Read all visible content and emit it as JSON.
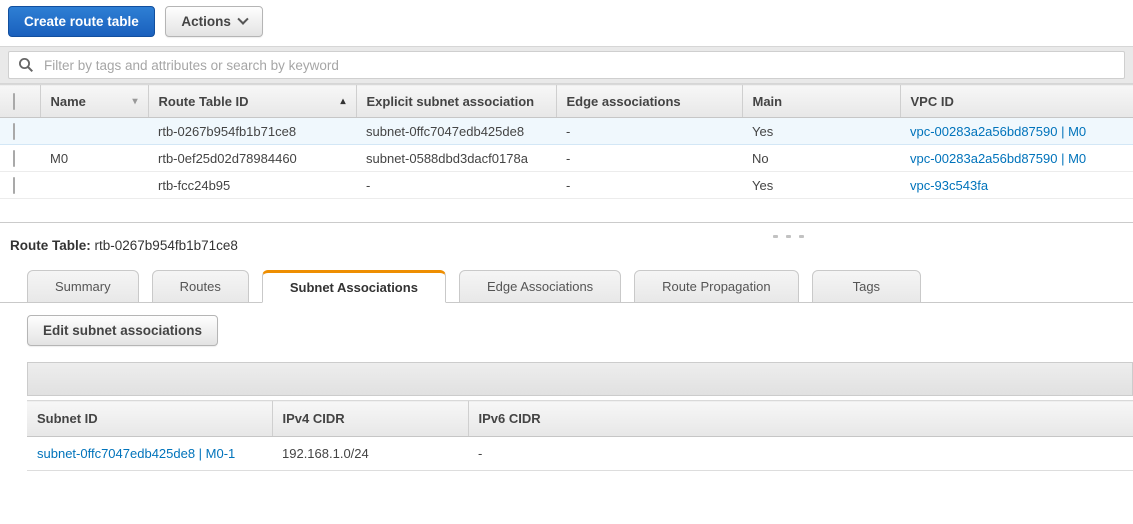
{
  "toolbar": {
    "create_button": "Create route table",
    "actions_button": "Actions"
  },
  "filter": {
    "placeholder": "Filter by tags and attributes or search by keyword"
  },
  "route_tables_table": {
    "columns": {
      "name": "Name",
      "route_table_id": "Route Table ID",
      "explicit_subnet_association": "Explicit subnet association",
      "edge_associations": "Edge associations",
      "main": "Main",
      "vpc_id": "VPC ID"
    },
    "rows": [
      {
        "selected": true,
        "name": "",
        "route_table_id": "rtb-0267b954fb1b71ce8",
        "explicit_subnet_association": "subnet-0ffc7047edb425de8",
        "edge_associations": "-",
        "main": "Yes",
        "vpc_id": "vpc-00283a2a56bd87590 | M0"
      },
      {
        "selected": false,
        "name": "M0",
        "route_table_id": "rtb-0ef25d02d78984460",
        "explicit_subnet_association": "subnet-0588dbd3dacf0178a",
        "edge_associations": "-",
        "main": "No",
        "vpc_id": "vpc-00283a2a56bd87590 | M0"
      },
      {
        "selected": false,
        "name": "",
        "route_table_id": "rtb-fcc24b95",
        "explicit_subnet_association": "-",
        "edge_associations": "-",
        "main": "Yes",
        "vpc_id": "vpc-93c543fa"
      }
    ]
  },
  "detail": {
    "label": "Route Table:",
    "route_table_id": "rtb-0267b954fb1b71ce8",
    "tabs": [
      "Summary",
      "Routes",
      "Subnet Associations",
      "Edge Associations",
      "Route Propagation",
      "Tags"
    ],
    "active_tab": "Subnet Associations",
    "edit_button": "Edit subnet associations",
    "subnet_table": {
      "columns": {
        "subnet_id": "Subnet ID",
        "ipv4_cidr": "IPv4 CIDR",
        "ipv6_cidr": "IPv6 CIDR"
      },
      "rows": [
        {
          "subnet_id": "subnet-0ffc7047edb425de8 | M0-1",
          "ipv4_cidr": "192.168.1.0/24",
          "ipv6_cidr": "-"
        }
      ]
    }
  },
  "colors": {
    "link_blue": "#0073bb",
    "active_tab_orange": "#ee8e01",
    "primary_button_blue": "#1f6bc0",
    "selected_row_bg": "#f0f8fd",
    "selected_checkbox_blue": "#1d6fd1"
  }
}
